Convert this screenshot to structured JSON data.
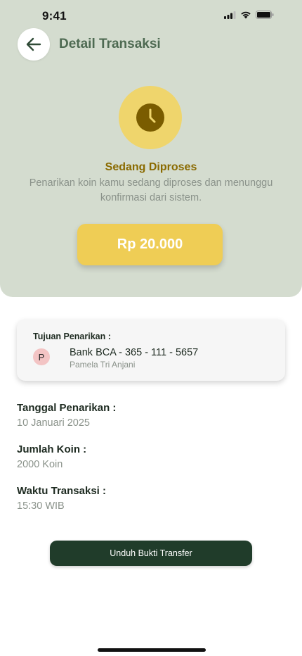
{
  "status_bar": {
    "time": "9:41"
  },
  "header": {
    "title": "Detail Transaksi"
  },
  "status": {
    "icon": "clock-icon",
    "title": "Sedang Diproses",
    "description": "Penarikan koin kamu sedang diproses dan menunggu konfirmasi dari sistem.",
    "amount": "Rp 20.000"
  },
  "destination": {
    "label": "Tujuan Penarikan :",
    "avatar_initial": "P",
    "bank": "Bank BCA - 365 - 111 - 5657",
    "name": "Pamela Tri Anjani"
  },
  "details": [
    {
      "label": "Tanggal Penarikan :",
      "value": "10 Januari 2025"
    },
    {
      "label": "Jumlah Koin :",
      "value": "2000 Koin"
    },
    {
      "label": "Waktu Transaksi  :",
      "value": "15:30 WIB"
    }
  ],
  "actions": {
    "download_label": "Unduh Bukti Transfer"
  },
  "colors": {
    "header_bg": "#d4dccf",
    "accent_yellow": "#efcd55",
    "status_text": "#8a6a00",
    "primary_dark_green": "#203c2a"
  }
}
